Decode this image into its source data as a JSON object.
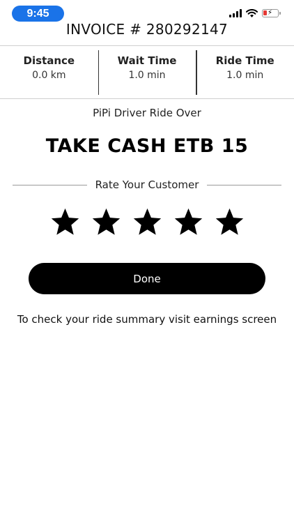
{
  "status_bar": {
    "time": "9:45",
    "icons": [
      "signal-icon",
      "wifi-icon",
      "battery-low-charging-icon"
    ],
    "accent": "#1a73e8",
    "battery_color": "#e53935"
  },
  "header": {
    "invoice_label": "INVOICE # 280292147"
  },
  "stats": [
    {
      "label": "Distance",
      "value": "0.0 km"
    },
    {
      "label": "Wait Time",
      "value": "1.0 min"
    },
    {
      "label": "Ride Time",
      "value": "1.0 min"
    }
  ],
  "ride": {
    "status_text": "PiPi Driver Ride Over",
    "cash_text": "TAKE CASH ETB 15"
  },
  "rating": {
    "label": "Rate Your Customer",
    "max_stars": 5,
    "selected": 5,
    "star_icon": "star-icon"
  },
  "actions": {
    "done_label": "Done"
  },
  "footer": {
    "hint": "To check your ride summary visit earnings screen"
  }
}
